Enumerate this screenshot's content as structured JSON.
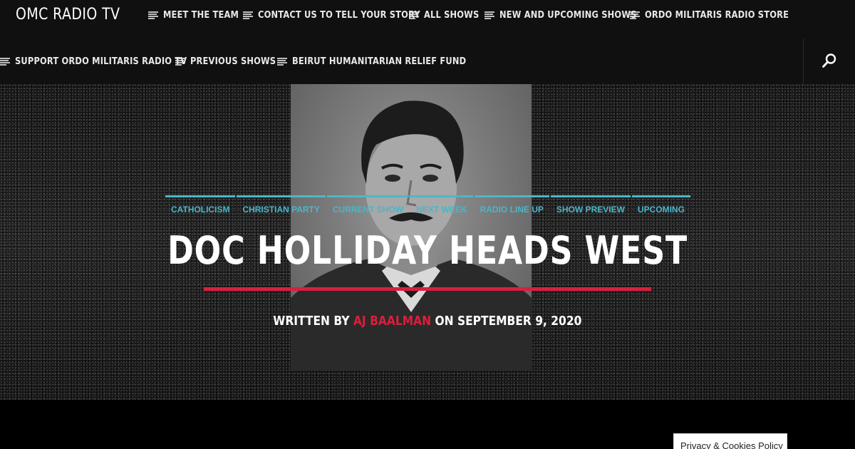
{
  "header": {
    "site_title": "OMC RADIO TV",
    "nav_row1": [
      {
        "label": "MEET THE TEAM"
      },
      {
        "label": "CONTACT US TO TELL YOUR STORY"
      },
      {
        "label": "ALL SHOWS"
      },
      {
        "label": "NEW AND UPCOMING SHOWS"
      },
      {
        "label": "ORDO MILITARIS RADIO STORE"
      }
    ],
    "nav_row2": [
      {
        "label": "SUPPORT ORDO MILITARIS RADIO TV"
      },
      {
        "label": "PREVIOUS SHOWS"
      },
      {
        "label": "BEIRUT HUMANITARIAN RELIEF FUND"
      }
    ],
    "search_icon": "search-icon"
  },
  "post": {
    "categories": [
      "CATHOLICISM",
      "CHRISTIAN PARTY",
      "CURRENT SHOW",
      "NEXT WEEK",
      "RADIO LINE UP",
      "SHOW PREVIEW",
      "UPCOMING"
    ],
    "title": "DOC HOLLIDAY HEADS WEST",
    "byline_prefix": "WRITTEN BY ",
    "author": "AJ BAALMAN",
    "byline_middle": " ON ",
    "date": "SEPTEMBER 9, 2020"
  },
  "footer": {
    "privacy_label": "Privacy & Cookies Policy"
  },
  "colors": {
    "accent_red": "#d8203d",
    "category_teal": "#49b6c8",
    "header_bg": "#101010"
  }
}
